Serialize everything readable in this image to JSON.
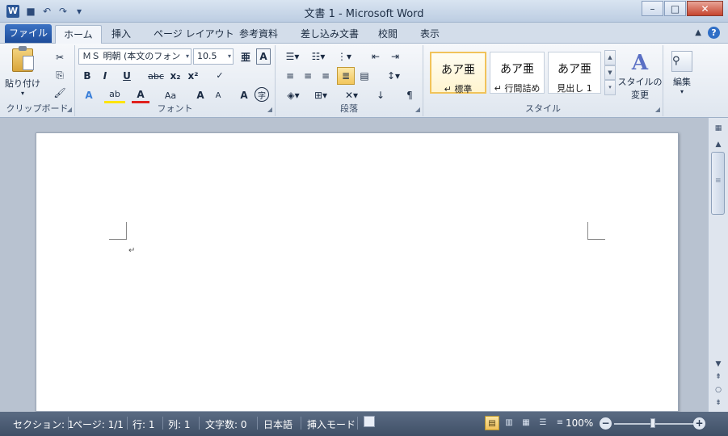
{
  "window": {
    "title": "文書 1 - Microsoft Word",
    "app_icon": "W"
  },
  "qat": [
    "save-icon",
    "undo-icon",
    "redo-icon",
    "customize-icon"
  ],
  "tabs": {
    "file": "ファイル",
    "items": [
      "ホーム",
      "挿入",
      "ページ レイアウト",
      "参考資料",
      "差し込み文書",
      "校閲",
      "表示"
    ],
    "help": "?"
  },
  "ribbon": {
    "clipboard": {
      "label": "クリップボード",
      "paste": "貼り付け"
    },
    "font": {
      "label": "フォント",
      "font_name": "ＭＳ 明朝 (本文のフォン",
      "font_size": "10.5",
      "bold": "B",
      "italic": "I",
      "underline": "U",
      "strike": "abc",
      "sub": "x₂",
      "sup": "x²",
      "case": "Aa",
      "grow": "A",
      "shrink": "A",
      "clear": "A",
      "enclose": "字"
    },
    "paragraph": {
      "label": "段落"
    },
    "styles": {
      "label": "スタイル",
      "items": [
        {
          "sample": "あア亜",
          "name": "↵ 標準"
        },
        {
          "sample": "あア亜",
          "name": "↵ 行間詰め"
        },
        {
          "sample": "あア亜",
          "name": "見出し 1"
        }
      ],
      "change_label_1": "スタイルの",
      "change_label_2": "変更"
    },
    "editing": {
      "label": "編集"
    }
  },
  "document": {
    "para_mark": "↵"
  },
  "status": {
    "section": "セクション: 1",
    "page": "ページ: 1/1",
    "line": "行: 1",
    "column": "列: 1",
    "word_count": "文字数: 0",
    "language": "日本語",
    "mode": "挿入モード",
    "zoom": "100%",
    "zoom_level": 1.0
  }
}
